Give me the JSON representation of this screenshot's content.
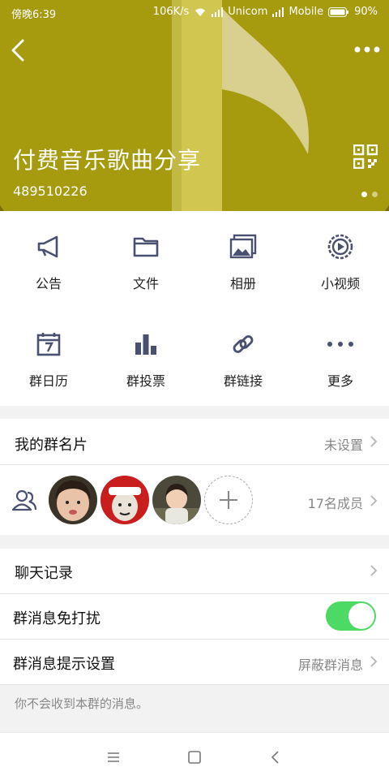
{
  "status_bar": {
    "time": "傍晚6:39",
    "speed": "106K/s",
    "carrier1": "Unicom",
    "carrier2": "Mobile",
    "battery": "90%"
  },
  "header": {
    "group_name": "付费音乐歌曲分享",
    "group_id": "489510226",
    "back_icon": "back-arrow-icon",
    "more_icon": "more-dots-icon",
    "qr_icon": "qr-code-icon",
    "bg_color": "#7a6f0c"
  },
  "actions": [
    {
      "label": "公告",
      "icon": "megaphone-icon"
    },
    {
      "label": "文件",
      "icon": "folder-icon"
    },
    {
      "label": "相册",
      "icon": "photos-icon"
    },
    {
      "label": "小视频",
      "icon": "video-icon"
    },
    {
      "label": "群日历",
      "icon": "calendar-icon"
    },
    {
      "label": "群投票",
      "icon": "poll-icon"
    },
    {
      "label": "群链接",
      "icon": "link-icon"
    },
    {
      "label": "更多",
      "icon": "more-icon"
    }
  ],
  "card": {
    "title": "我的群名片",
    "value": "未设置"
  },
  "members": {
    "count_label": "17名成员",
    "icon": "members-icon"
  },
  "settings": {
    "chat_history": "聊天记录",
    "mute_label": "群消息免打扰",
    "mute_on": true,
    "notify_label": "群消息提示设置",
    "notify_value": "屏蔽群消息",
    "hint": "你不会收到本群的消息。"
  },
  "colors": {
    "toggle_on": "#4cd964",
    "icon_color": "#4a5070"
  }
}
